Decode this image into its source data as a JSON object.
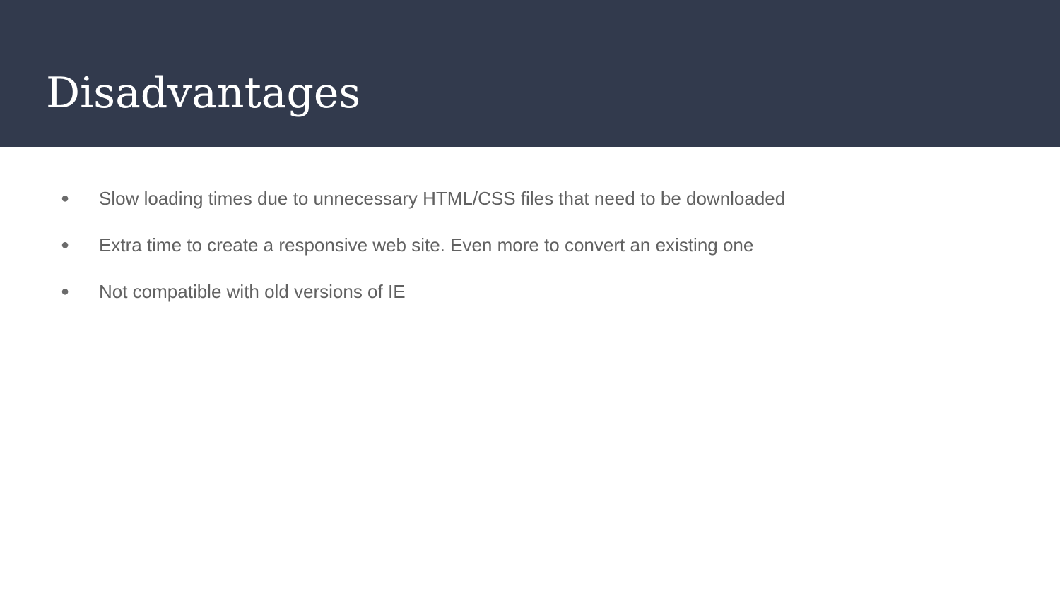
{
  "slide": {
    "title": "Disadvantages",
    "bullet_symbol": "●",
    "bullets": [
      "Slow loading times due to unnecessary HTML/CSS files that need to be downloaded",
      "Extra time to create a responsive web site. Even more to convert an existing one",
      "Not compatible with old versions of IE"
    ]
  },
  "colors": {
    "header_background": "#323a4d",
    "title_text": "#ffffff",
    "body_text": "#616161",
    "slide_background": "#ffffff"
  }
}
